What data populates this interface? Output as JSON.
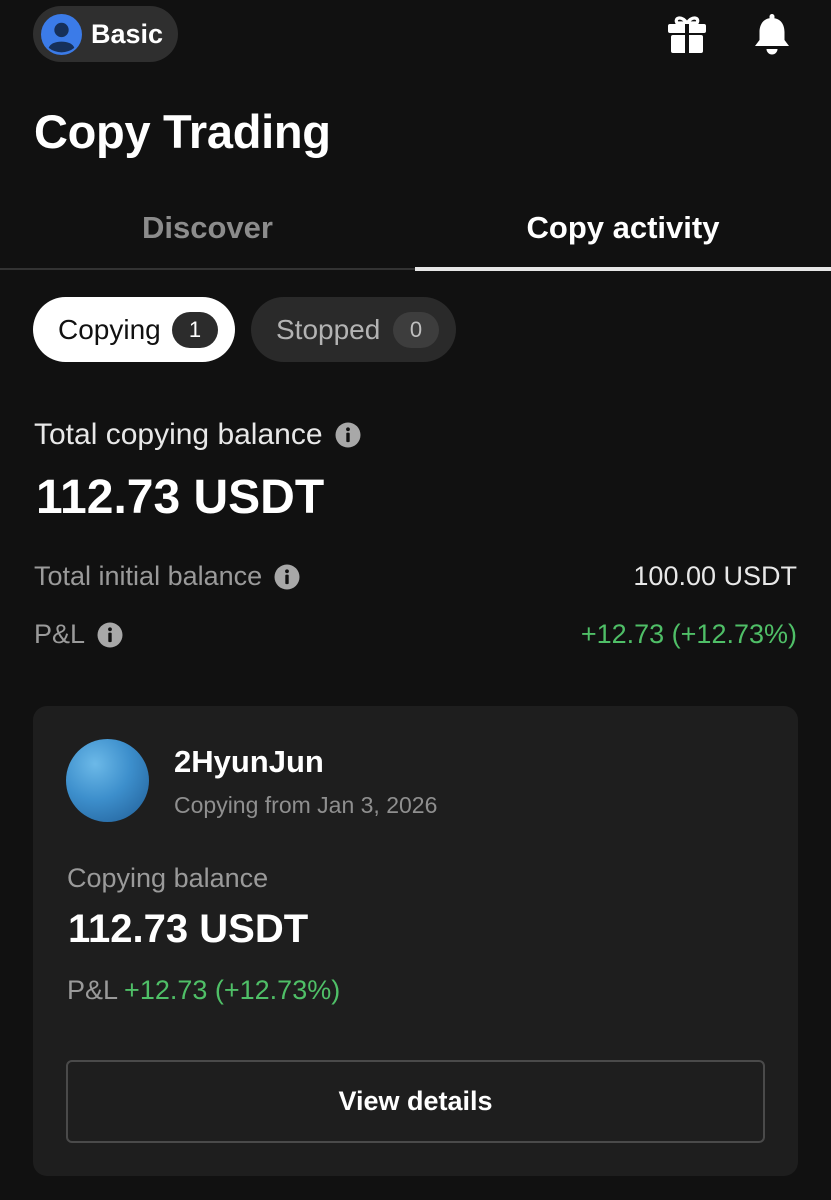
{
  "header": {
    "account_label": "Basic",
    "icons": [
      "user-avatar-icon",
      "gift-icon",
      "bell-icon"
    ]
  },
  "title": "Copy Trading",
  "tabs": [
    {
      "label": "Discover",
      "active": false
    },
    {
      "label": "Copy activity",
      "active": true
    }
  ],
  "filters": [
    {
      "label": "Copying",
      "count": "1",
      "active": true
    },
    {
      "label": "Stopped",
      "count": "0",
      "active": false
    }
  ],
  "summary": {
    "total_label": "Total copying balance",
    "total_value": "112.73 USDT",
    "initial_label": "Total initial balance",
    "initial_value": "100.00 USDT",
    "pnl_label": "P&L",
    "pnl_value": "+12.73 (+12.73%)"
  },
  "trader_card": {
    "name": "2HyunJun",
    "since": "Copying from Jan 3, 2026",
    "balance_label": "Copying balance",
    "balance_value": "112.73 USDT",
    "pnl_label": "P&L",
    "pnl_value": "+12.73 (+12.73%)",
    "button_label": "View details"
  },
  "colors": {
    "background": "#111111",
    "card": "#1e1e1e",
    "profit_green": "#4fbf67",
    "avatar_blue": "#3d8fcc"
  }
}
